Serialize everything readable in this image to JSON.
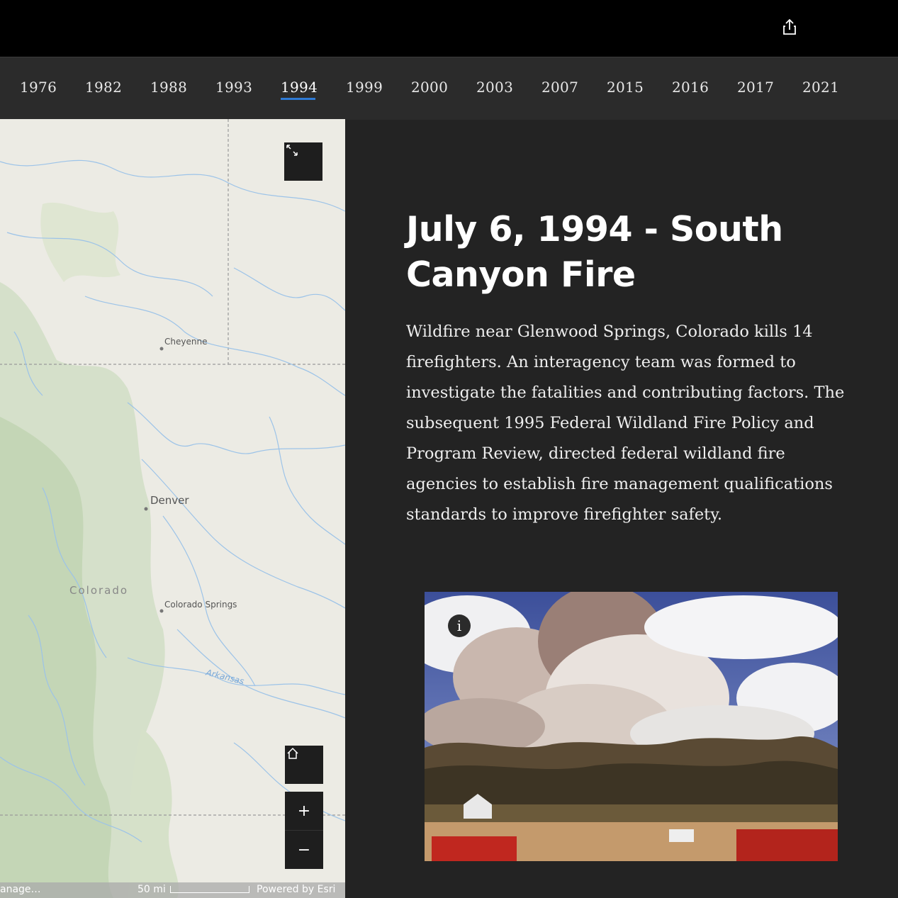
{
  "timeline": {
    "years": [
      "1976",
      "1982",
      "1988",
      "1993",
      "1994",
      "1999",
      "2000",
      "2003",
      "2007",
      "2015",
      "2016",
      "2017",
      "2021"
    ],
    "active": "1994"
  },
  "map": {
    "labels": {
      "cheyenne": "Cheyenne",
      "denver": "Denver",
      "colorado": "Colorado",
      "colorado_springs": "Colorado Springs",
      "arkansas": "Arkansas"
    },
    "attribution": {
      "left": "anage…",
      "scale": "50 mi",
      "powered": "Powered by Esri"
    },
    "controls": {
      "zoom_in": "+",
      "zoom_out": "−"
    }
  },
  "story": {
    "title": "July 6, 1994 - South Canyon Fire",
    "body": "Wildfire near Glenwood Springs, Colorado kills 14 firefighters. An interagency team was formed to investigate the fatalities and contributing factors. The subsequent 1995 Federal Wildland Fire Policy and Program Review, directed federal wildland fire agencies to establish fire management qualifications standards to improve firefighter safety.",
    "info_glyph": "i"
  },
  "icons": {
    "share": "share-icon",
    "expand": "expand-icon",
    "home": "home-icon",
    "info": "info-icon"
  },
  "colors": {
    "accent": "#2e7bd6",
    "panel": "#232323",
    "topbar": "#000000"
  }
}
